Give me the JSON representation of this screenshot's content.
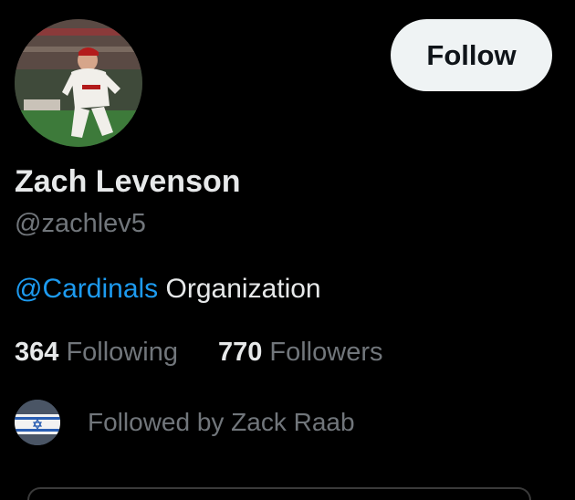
{
  "profile": {
    "display_name": "Zach Levenson",
    "handle": "@zachlev5",
    "bio_mention": "@Cardinals",
    "bio_text": " Organization"
  },
  "actions": {
    "follow_label": "Follow"
  },
  "stats": {
    "following_count": "364",
    "following_label": " Following",
    "followers_count": "770",
    "followers_label": " Followers"
  },
  "followed_by": {
    "text": "Followed by Zack Raab"
  },
  "colors": {
    "background": "#000000",
    "link": "#1d9bf0",
    "muted": "#71767b",
    "follow_button_bg": "#eff3f4"
  }
}
